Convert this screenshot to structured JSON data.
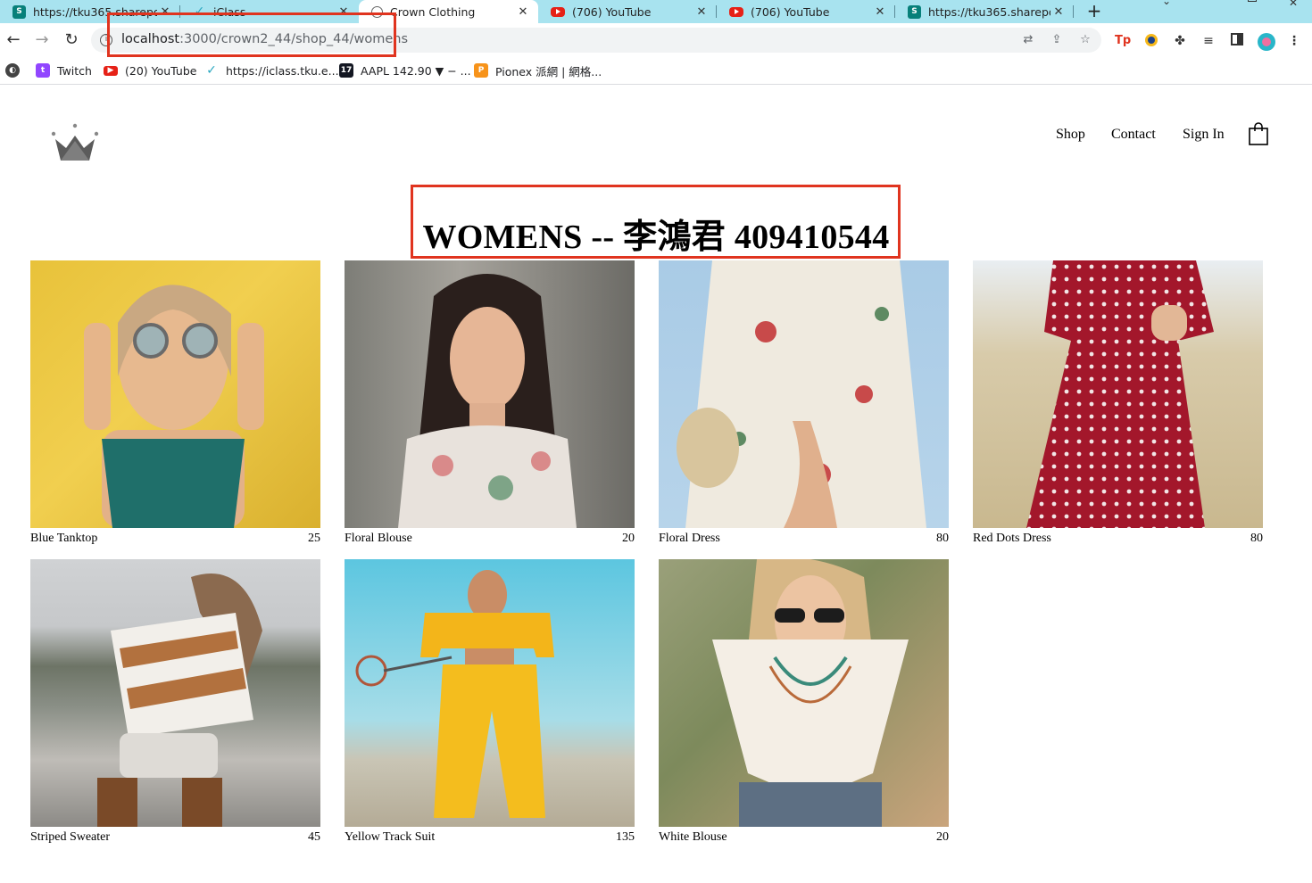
{
  "browser": {
    "tabs": [
      {
        "title": "https://tku365.sharepoi",
        "icon": "sharepoint-icon",
        "active": false
      },
      {
        "title": "iClass",
        "icon": "iclass-icon",
        "active": false
      },
      {
        "title": "Crown Clothing",
        "icon": "globe-icon",
        "active": true
      },
      {
        "title": "(706) YouTube",
        "icon": "youtube-icon",
        "active": false
      },
      {
        "title": "(706) YouTube",
        "icon": "youtube-icon",
        "active": false
      },
      {
        "title": "https://tku365.sharepoi",
        "icon": "sharepoint-icon",
        "active": false
      }
    ],
    "close_glyph": "✕",
    "new_tab_glyph": "+",
    "url_host": "localhost",
    "url_path": ":3000/crown2_44/shop_44/womens",
    "bookmarks": [
      {
        "label": "Twitch",
        "icon": "twitch-icon"
      },
      {
        "label": "(20) YouTube",
        "icon": "youtube-icon"
      },
      {
        "label": "https://iclass.tku.e...",
        "icon": "iclass-icon"
      },
      {
        "label": "AAPL 142.90 ▼ − ...",
        "icon": "tradingview-icon"
      },
      {
        "label": "Pionex 派網 | 網格...",
        "icon": "pionex-icon"
      }
    ]
  },
  "site": {
    "nav": {
      "shop": "Shop",
      "contact": "Contact",
      "sign_in": "Sign In"
    },
    "heading": "WOMENS -- 李鴻君 409410544",
    "products": [
      {
        "name": "Blue Tanktop",
        "price": "25",
        "image": "woman-yellow-wall-round-sunglasses"
      },
      {
        "name": "Floral Blouse",
        "price": "20",
        "image": "woman-off-shoulder-floral-top"
      },
      {
        "name": "Floral Dress",
        "price": "80",
        "image": "floral-wrap-dress-straw-bag"
      },
      {
        "name": "Red Dots Dress",
        "price": "80",
        "image": "red-polka-dot-dress-field"
      },
      {
        "name": "Striped Sweater",
        "price": "45",
        "image": "woman-striped-sweater-beach"
      },
      {
        "name": "Yellow Track Suit",
        "price": "135",
        "image": "yellow-tracksuit-basketball-court"
      },
      {
        "name": "White Blouse",
        "price": "20",
        "image": "white-blouse-braids-sunglasses"
      }
    ]
  }
}
